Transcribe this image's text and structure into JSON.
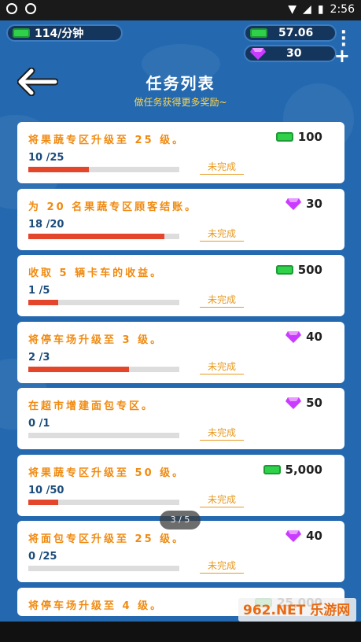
{
  "statusbar": {
    "time": "2:56"
  },
  "hud": {
    "income": "114/分钟",
    "cash": "57.06",
    "gems": "30",
    "menu": "⋮",
    "plus": "+"
  },
  "header": {
    "title": "任务列表",
    "subtitle": "做任务获得更多奖励~"
  },
  "tasks": [
    {
      "text": "将果蔬专区升级至 25 级。",
      "reward_type": "cash",
      "reward": "100",
      "progress": "10 /25",
      "fraction": 0.4,
      "status": "未完成"
    },
    {
      "text": "为 20 名果蔬专区顾客结账。",
      "reward_type": "gem",
      "reward": "30",
      "progress": "18 /20",
      "fraction": 0.9,
      "status": "未完成"
    },
    {
      "text": "收取 5 辆卡车的收益。",
      "reward_type": "cash",
      "reward": "500",
      "progress": "1 /5",
      "fraction": 0.2,
      "status": "未完成"
    },
    {
      "text": "将停车场升级至 3 级。",
      "reward_type": "gem",
      "reward": "40",
      "progress": "2 /3",
      "fraction": 0.667,
      "status": "未完成"
    },
    {
      "text": "在超市增建面包专区。",
      "reward_type": "gem",
      "reward": "50",
      "progress": "0 /1",
      "fraction": 0,
      "status": "未完成"
    },
    {
      "text": "将果蔬专区升级至 50 级。",
      "reward_type": "cash",
      "reward": "5,000",
      "progress": "10 /50",
      "fraction": 0.2,
      "status": "未完成"
    },
    {
      "text": "将面包专区升级至 25 级。",
      "reward_type": "gem",
      "reward": "40",
      "progress": "0 /25",
      "fraction": 0,
      "status": "未完成"
    },
    {
      "text": "将停车场升级至 4 级。",
      "reward_type": "cash",
      "reward": "25,000",
      "progress": "",
      "fraction": 0,
      "status": ""
    }
  ],
  "pager": "3 / 5",
  "watermark": "962.NET 乐游网",
  "colors": {
    "accent": "#f08a10",
    "progress": "#e4462c",
    "bg": "#2469b0"
  }
}
